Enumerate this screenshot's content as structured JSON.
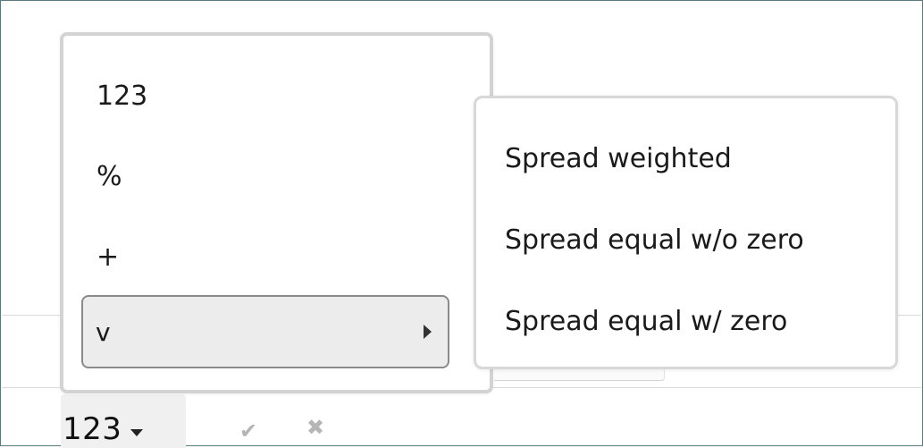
{
  "toolbar": {
    "unit_value": "123",
    "confirm_icon": "✔",
    "cancel_icon": "✖"
  },
  "menu": {
    "items": [
      {
        "label": "123"
      },
      {
        "label": "%"
      },
      {
        "label": "+"
      },
      {
        "label": "v",
        "has_submenu": true,
        "highlighted": true
      }
    ]
  },
  "submenu": {
    "items": [
      {
        "label": "Spread weighted"
      },
      {
        "label": "Spread equal w/o zero"
      },
      {
        "label": "Spread equal w/ zero"
      }
    ]
  },
  "icons": {
    "unit_dropdown": "chevron-down-icon",
    "submenu_indicator": "chevron-right-icon",
    "confirm": "check-icon",
    "cancel": "close-icon"
  },
  "colors": {
    "border": "#d3d3d3",
    "highlight_bg": "#ececec",
    "highlight_border": "#8a8a8a",
    "icon_muted": "#b5b5b5",
    "frame_border": "#5a7a82"
  }
}
